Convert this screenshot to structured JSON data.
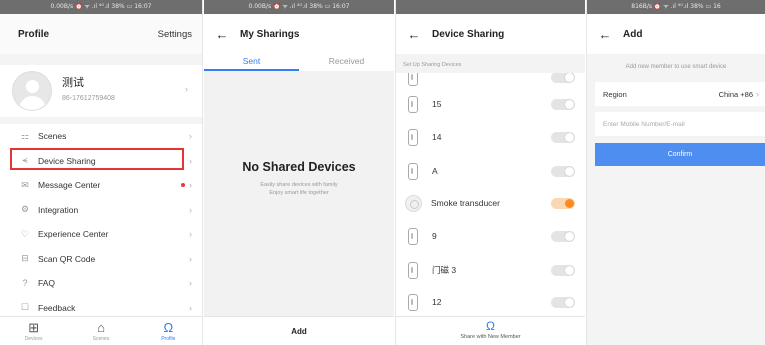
{
  "status_bars": {
    "p1": "0.00B/s ⏰ ᯤ .ıl ⁴ᴳ.ıl 38% ▭ 16:07",
    "p2": "0.00B/s ⏰ ᯤ .ıl ⁴ᴳ.ıl 38% ▭ 16:07",
    "p4": "816B/s ⏰ ᯤ .ıl ⁴ᴳ.ıl 38% ▭ 16"
  },
  "profile_screen": {
    "title": "Profile",
    "settings_label": "Settings",
    "user_name": "测试",
    "user_phone": "86-17612759408",
    "menu": [
      {
        "label": "Scenes",
        "icon": "scenes-icon",
        "glyph": "⚏"
      },
      {
        "label": "Device Sharing",
        "icon": "share-icon",
        "glyph": "⪪"
      },
      {
        "label": "Message Center",
        "icon": "message-icon",
        "glyph": "✉"
      },
      {
        "label": "Integration",
        "icon": "integration-icon",
        "glyph": "⚙"
      },
      {
        "label": "Experience Center",
        "icon": "heart-icon",
        "glyph": "♡"
      },
      {
        "label": "Scan QR Code",
        "icon": "qr-code-icon",
        "glyph": "⊟"
      },
      {
        "label": "FAQ",
        "icon": "help-icon",
        "glyph": "?"
      },
      {
        "label": "Feedback",
        "icon": "feedback-icon",
        "glyph": "☐"
      }
    ],
    "bottom_tabs": [
      {
        "label": "Devices",
        "icon": "grid-icon",
        "glyph": "⊞"
      },
      {
        "label": "Scenes",
        "icon": "home-icon",
        "glyph": "⌂"
      },
      {
        "label": "Profile",
        "icon": "profile-icon",
        "glyph": "Ω"
      }
    ]
  },
  "my_sharings_screen": {
    "title": "My Sharings",
    "tabs": [
      "Sent",
      "Received"
    ],
    "empty_title": "No Shared Devices",
    "empty_subtitle_line1": "Easily share devices with family",
    "empty_subtitle_line2": "Enjoy smart life together",
    "add_label": "Add"
  },
  "device_sharing_screen": {
    "title": "Device Sharing",
    "section_label": "Set Up Sharing Devices",
    "devices": [
      {
        "name": "15",
        "enabled": false
      },
      {
        "name": "14",
        "enabled": false
      },
      {
        "name": "A",
        "enabled": false
      },
      {
        "name": "Smoke transducer",
        "enabled": true
      },
      {
        "name": "9",
        "enabled": false
      },
      {
        "name": "门磁 3",
        "enabled": false
      },
      {
        "name": "12",
        "enabled": false
      }
    ],
    "share_label": "Share with New Member"
  },
  "add_screen": {
    "title": "Add",
    "hint": "Add new member to use smart device",
    "region_label": "Region",
    "region_value": "China +86",
    "mobile_placeholder": "Enter Mobile Number/E-mail",
    "confirm_label": "Confirm"
  },
  "colors": {
    "accent": "#2f7ff0",
    "highlight_box": "#e23535",
    "toggle_on": "#ff8a1f",
    "confirm_button": "#4d8ef0"
  }
}
